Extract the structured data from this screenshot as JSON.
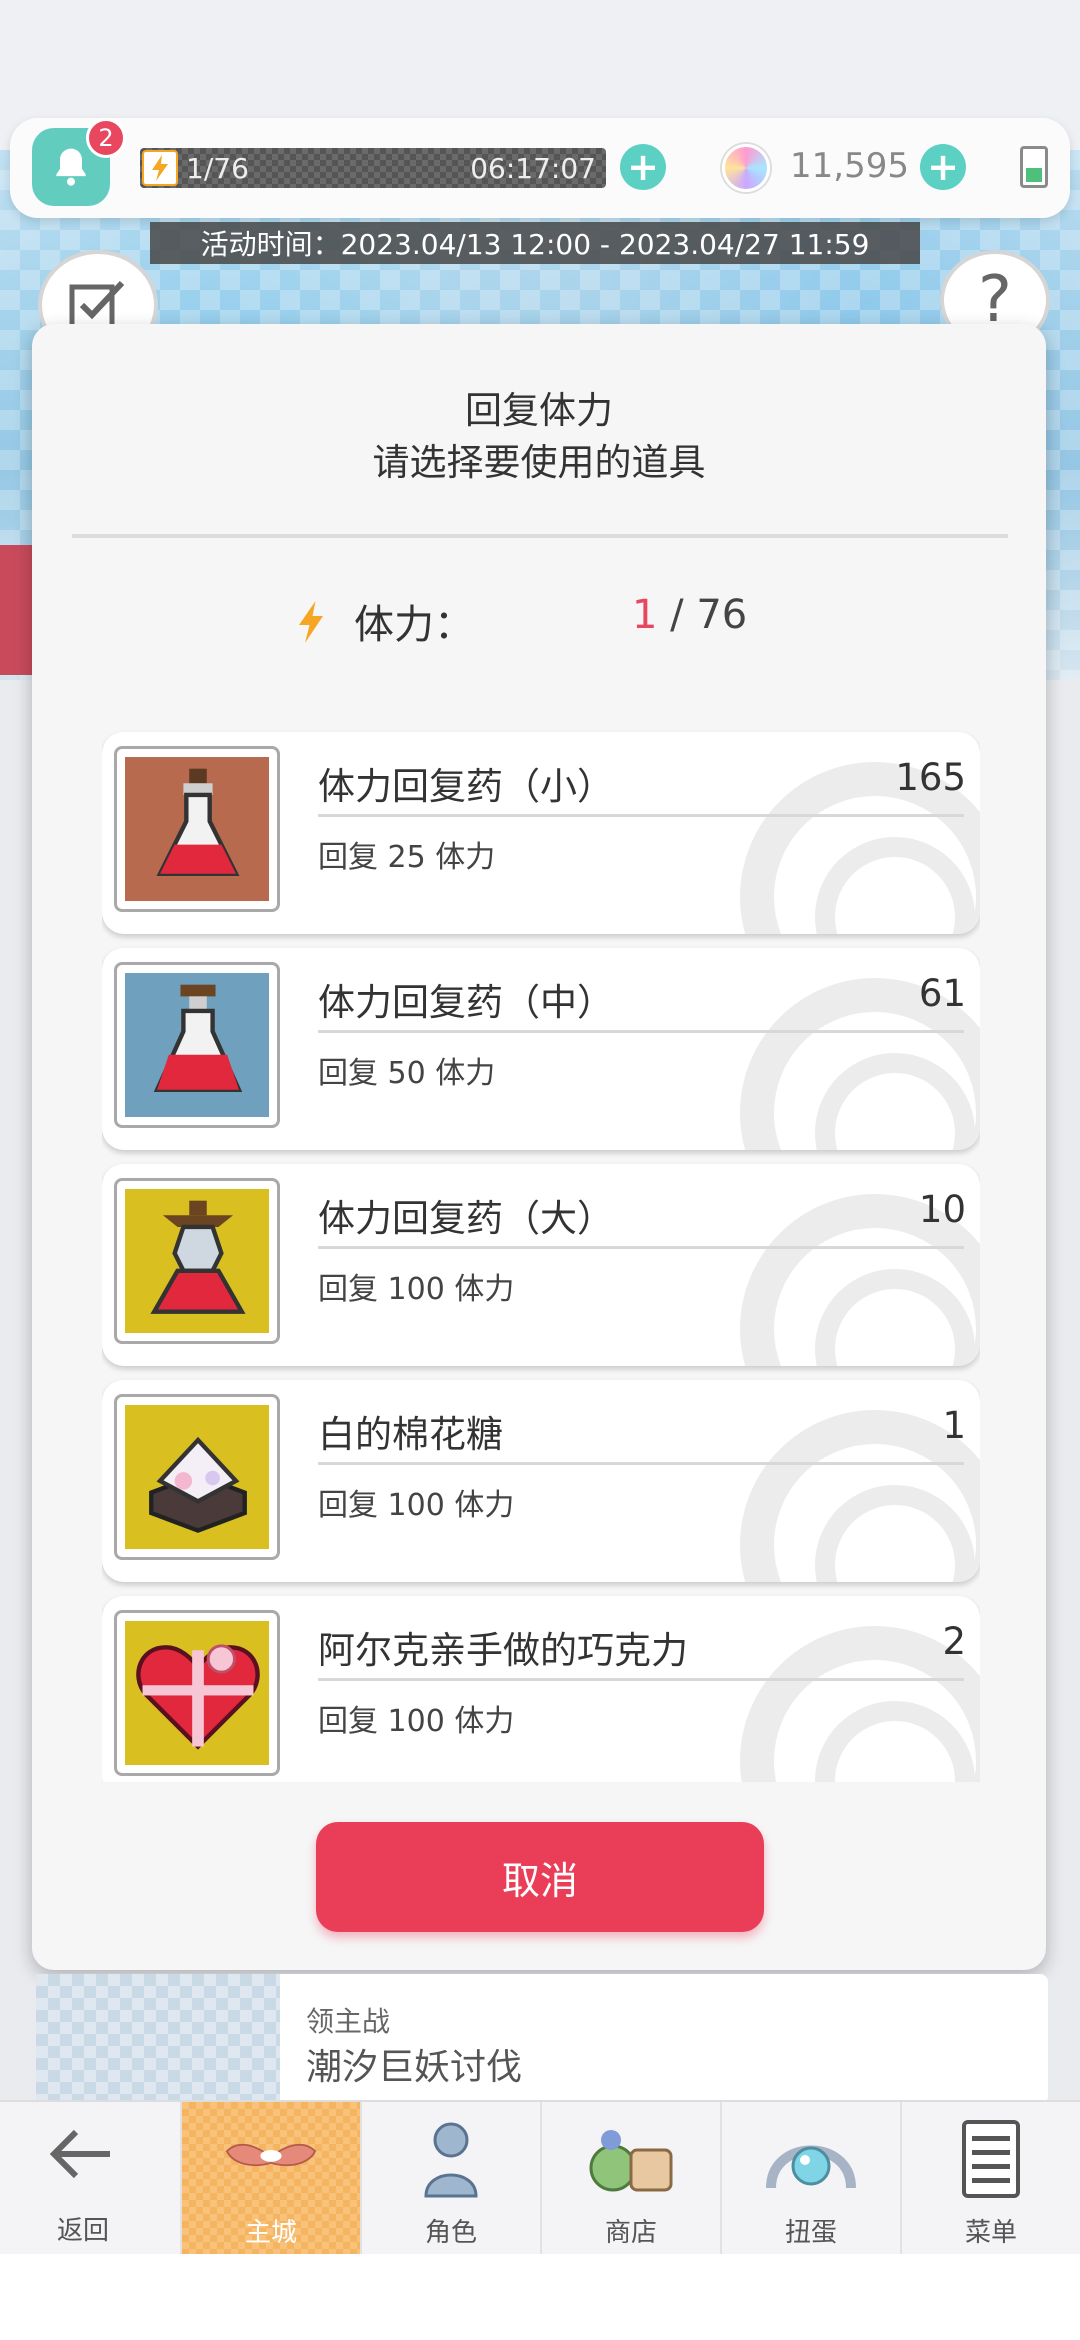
{
  "status_bar": {
    "notification_count": "2",
    "stamina": "1/76",
    "stamina_timer": "06:17:07",
    "gems": "11,595",
    "event_time": "活动时间：2023.04/13 12:00 - 2023.04/27 11:59"
  },
  "dialog": {
    "title": "回复体力",
    "subtitle": "请选择要使用的道具",
    "stamina_label": "体力：",
    "stamina_current": "1",
    "stamina_sep": " / ",
    "stamina_max": "76",
    "items": [
      {
        "name": "体力回复药（小）",
        "count": "165",
        "desc": "回复 25 体力",
        "bg": "#b86a4f",
        "icon": "small-potion-icon"
      },
      {
        "name": "体力回复药（中）",
        "count": "61",
        "desc": "回复 50 体力",
        "bg": "#6fa0bd",
        "icon": "medium-potion-icon"
      },
      {
        "name": "体力回复药（大）",
        "count": "10",
        "desc": "回复 100 体力",
        "bg": "#d9c020",
        "icon": "large-potion-icon"
      },
      {
        "name": "白的棉花糖",
        "count": "1",
        "desc": "回复 100 体力",
        "bg": "#d9c020",
        "icon": "marshmallow-icon"
      },
      {
        "name": "阿尔克亲手做的巧克力",
        "count": "2",
        "desc": "回复 100 体力",
        "bg": "#d9c020",
        "icon": "heart-chocolate-icon"
      }
    ],
    "cancel_label": "取消"
  },
  "background": {
    "boss_sub": "领主战",
    "boss_title": "潮汐巨妖讨伐"
  },
  "nav": {
    "back": "返回",
    "items": [
      {
        "label": "主城",
        "icon": "main-city-icon",
        "active": true
      },
      {
        "label": "角色",
        "icon": "character-icon",
        "active": false
      },
      {
        "label": "商店",
        "icon": "shop-icon",
        "active": false
      },
      {
        "label": "扭蛋",
        "icon": "gacha-icon",
        "active": false
      },
      {
        "label": "菜单",
        "icon": "menu-icon",
        "active": false
      }
    ]
  },
  "colors": {
    "accent": "#ea3d58",
    "teal": "#5cd0c2",
    "stamina_orange": "#f5a623"
  }
}
